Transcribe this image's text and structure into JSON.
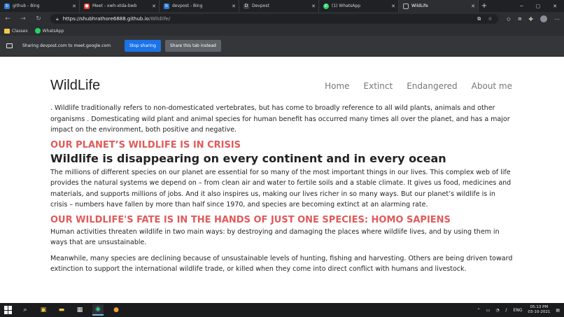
{
  "browser": {
    "tabs": [
      {
        "label": "github - Bing",
        "favicon": "b",
        "color": "#2b79d3"
      },
      {
        "label": "Meet - xwh-xtda-bwb",
        "favicon": "●",
        "color": "#ea4335"
      },
      {
        "label": "devpost - Bing",
        "favicon": "b",
        "color": "#2b79d3"
      },
      {
        "label": "Devpost",
        "favicon": "D",
        "color": "#3a3f4a"
      },
      {
        "label": "(1) WhatsApp",
        "favicon": "✆",
        "color": "#25d366"
      },
      {
        "label": "WildLife",
        "favicon": "▢",
        "color": "#5f6368",
        "active": true
      }
    ],
    "url_host": "https://shubhrathore6888.github.io",
    "url_path": "/Wildlife/",
    "bookmarks": [
      {
        "label": "Classes",
        "color": "#f2c94c"
      },
      {
        "label": "WhatsApp",
        "color": "#25d366"
      }
    ]
  },
  "share_banner": {
    "text": "Sharing devpost.com to meet.google.com",
    "stop_label": "Stop sharing",
    "share_tab_label": "Share this tab instead"
  },
  "site": {
    "logo": "WildLife",
    "nav": [
      "Home",
      "Extinct",
      "Endangered",
      "About me"
    ]
  },
  "content": {
    "intro": ". Wildlife traditionally refers to non-domesticated vertebrates, but has come to broadly reference to all wild plants, animals and other organisms . Domesticating wild plant and animal species for human benefit has occurred many times all over the planet, and has a major impact on the environment, both positive and negative.",
    "heading1": "OUR PLANET’S WILDLIFE IS IN CRISIS",
    "heading2": "Wildlife is disappearing on every continent and in every ocean",
    "para1": "The millions of different species on our planet are essential for so many of the most important things in our lives. This complex web of life provides the natural systems we depend on – from clean air and water to fertile soils and a stable climate. It gives us food, medicines and materials, and supports millions of jobs. And it also inspires us, making our lives richer in so many ways. But our planet’s wildlife is in crisis – numbers have fallen by more than half since 1970, and species are becoming extinct at an alarming rate.",
    "heading3": "OUR WILDLIFE'S FATE IS IN THE HANDS OF JUST ONE SPECIES: HOMO SAPIENS",
    "para2": "Human activities threaten wildlife in two main ways: by destroying and damaging the places where wildlife lives, and by using them in ways that are unsustainable.",
    "para3": "Meanwhile, many species are declining because of unsustainable levels of hunting, fishing and harvesting. Others are being driven toward extinction to support the international wildlife trade, or killed when they come into direct conflict with humans and livestock."
  },
  "taskbar": {
    "lang": "ENG",
    "time": "05:13 PM",
    "date": "03-10-2021"
  }
}
